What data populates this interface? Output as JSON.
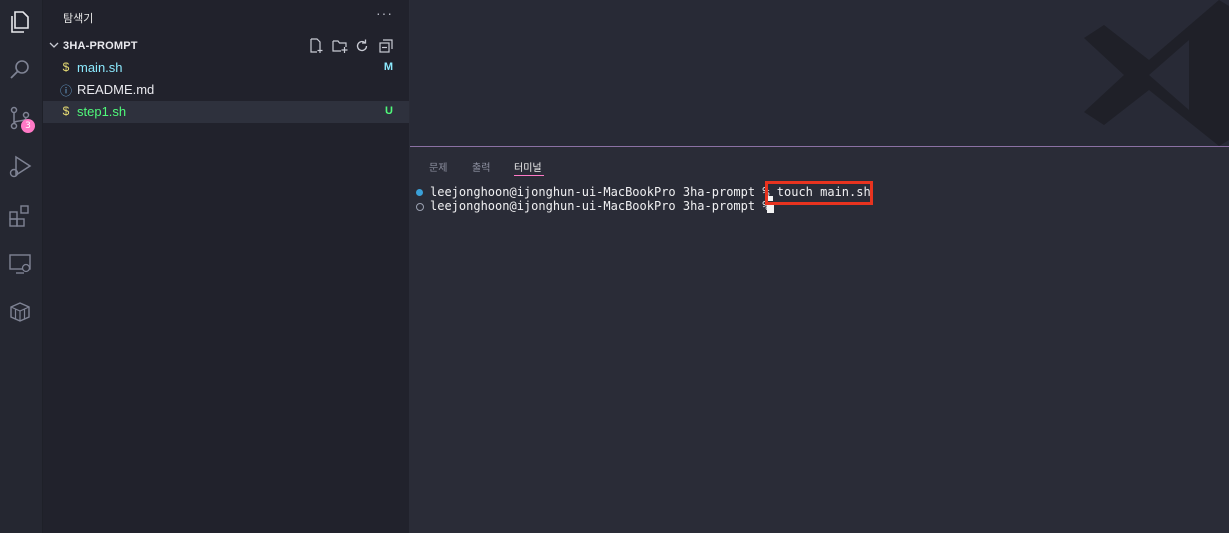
{
  "sidebar": {
    "title": "탐색기",
    "more": "···",
    "folder": "3HA-PROMPT",
    "files": [
      {
        "name": "main.sh",
        "icon": "$",
        "status": "M",
        "color": "#8be9fd",
        "icon_color": "#e6db74"
      },
      {
        "name": "README.md",
        "icon": "ⓘ",
        "status": "",
        "color": "#e9e9ee",
        "icon_color": "#6ca7d8"
      },
      {
        "name": "step1.sh",
        "icon": "$",
        "status": "U",
        "color": "#50fa7b",
        "icon_color": "#e6db74"
      }
    ]
  },
  "activity": {
    "scm_badge": "3"
  },
  "panel": {
    "tabs": [
      "문제",
      "출력",
      "터미널"
    ],
    "active_tab": "터미널",
    "lines": [
      {
        "prompt": "leejonghoon@ijonghun-ui-MacBookPro 3ha-prompt % ",
        "command": "touch main.sh"
      },
      {
        "prompt": "leejonghoon@ijonghun-ui-MacBookPro 3ha-prompt % ",
        "command": ""
      }
    ]
  },
  "colors": {
    "accent": "#ff79c6",
    "highlight": "#e8331f",
    "modified": "#8be9fd",
    "untracked": "#50fa7b"
  }
}
